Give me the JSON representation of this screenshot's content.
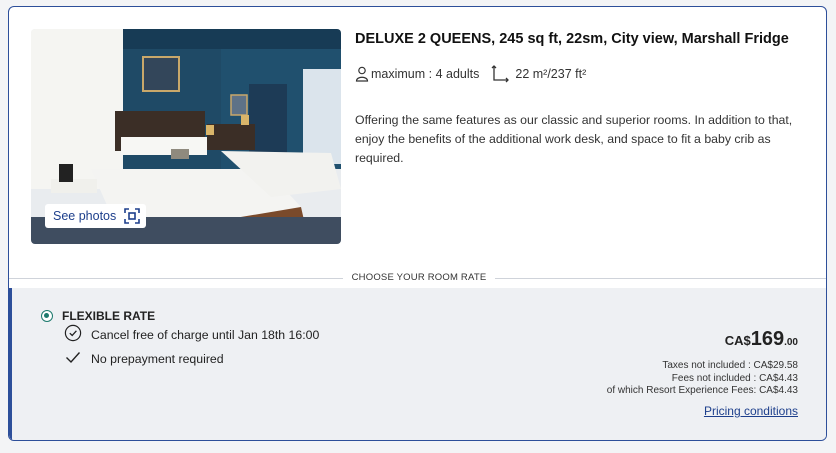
{
  "room": {
    "title": "DELUXE 2 QUEENS, 245 sq ft, 22sm, City view, Marshall Fridge",
    "capacity": "maximum : 4 adults",
    "size": "22 m²/237 ft²",
    "description": "Offering the same features as our classic and superior rooms. In addition to that, enjoy the benefits of the additional work desk, and space to fit a baby crib as required.",
    "see_photos_label": "See photos"
  },
  "rate_section": {
    "heading": "CHOOSE YOUR ROOM RATE"
  },
  "rate": {
    "name": "FLEXIBLE RATE",
    "selected": true,
    "conditions": [
      {
        "icon": "clock-icon",
        "text": "Cancel free of charge until Jan 18th 16:00"
      },
      {
        "icon": "check-icon",
        "text": "No prepayment required"
      }
    ],
    "price": {
      "currency": "CA$",
      "integer": "169",
      "decimal": ".00"
    },
    "taxes": "Taxes not included : CA$29.58",
    "fees": "Fees not included : CA$4.43",
    "resort_fees": "of which Resort Experience Fees: CA$4.43",
    "pricing_link": "Pricing conditions"
  },
  "colors": {
    "accent": "#2d4f9a",
    "link": "#1d3f8c",
    "radio": "#1e7a6e",
    "panel_bg": "#eef0f3"
  }
}
